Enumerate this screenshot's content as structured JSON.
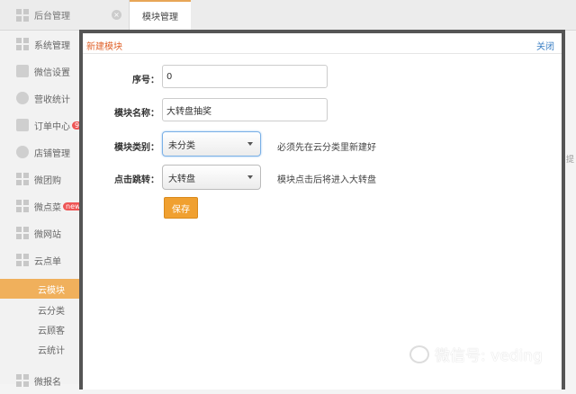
{
  "tabs": [
    {
      "label": "后台管理",
      "close": "×"
    },
    {
      "label": "模块管理"
    }
  ],
  "sidebar": {
    "items": [
      {
        "label": "系统管理"
      },
      {
        "label": "微信设置"
      },
      {
        "label": "营收统计"
      },
      {
        "label": "订单中心",
        "badge": "9"
      },
      {
        "label": "店铺管理"
      },
      {
        "label": "微团购"
      },
      {
        "label": "微点菜",
        "badge": "new"
      },
      {
        "label": "微网站"
      },
      {
        "label": "云点单"
      }
    ],
    "sub_items": [
      {
        "label": "云模块"
      },
      {
        "label": "云分类"
      },
      {
        "label": "云顾客"
      },
      {
        "label": "云统计"
      }
    ],
    "bottom_item": {
      "label": "微报名"
    }
  },
  "modal": {
    "title": "新建模块",
    "close_label": "关闭",
    "fields": {
      "order": {
        "label": "序号：",
        "value": "0"
      },
      "name": {
        "label": "模块名称：",
        "value": "大转盘抽奖"
      },
      "category": {
        "label": "模块类别：",
        "value": "未分类",
        "hint": "必须先在云分类里新建好"
      },
      "jump": {
        "label": "点击跳转：",
        "value": "大转盘",
        "hint": "模块点击后将进入大转盘"
      }
    },
    "save_label": "保存"
  },
  "watermark": "微信号: veding",
  "edge_text": "提"
}
